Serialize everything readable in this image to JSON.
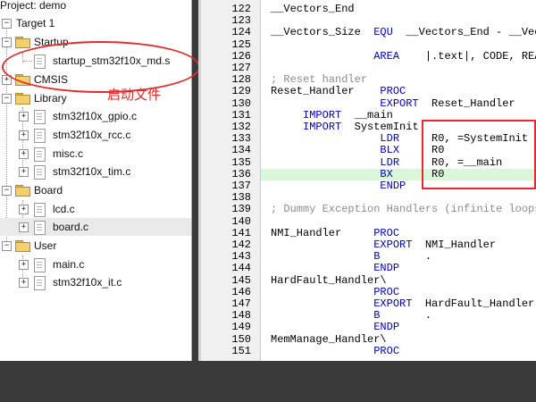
{
  "project": {
    "title": "Project: demo",
    "target": "Target 1",
    "groups": [
      {
        "name": "Startup",
        "files": [
          "startup_stm32f10x_md.s"
        ]
      },
      {
        "name": "CMSIS",
        "files": []
      },
      {
        "name": "Library",
        "files": [
          "stm32f10x_gpio.c",
          "stm32f10x_rcc.c",
          "misc.c",
          "stm32f10x_tim.c"
        ]
      },
      {
        "name": "Board",
        "files": [
          "lcd.c",
          "board.c"
        ]
      },
      {
        "name": "User",
        "files": [
          "main.c",
          "stm32f10x_it.c"
        ]
      }
    ]
  },
  "annotation": {
    "label": "启动文件",
    "color": "#e8282a"
  },
  "editor": {
    "highlight_line": "136",
    "lines": [
      {
        "no": "122",
        "code": "__Vectors_End",
        "kind": "plain"
      },
      {
        "no": "123",
        "code": "",
        "kind": "plain"
      },
      {
        "no": "124",
        "code": "__Vectors_Size  EQU  __Vectors_End - __Vectors",
        "kind": "plain"
      },
      {
        "no": "125",
        "code": "",
        "kind": "plain"
      },
      {
        "no": "126",
        "code": "                AREA    |.text|, CODE, READONLY",
        "kind": "plain"
      },
      {
        "no": "127",
        "code": "",
        "kind": "plain"
      },
      {
        "no": "128",
        "code": "; Reset handler",
        "kind": "comment"
      },
      {
        "no": "129",
        "code": "Reset_Handler    PROC",
        "kind": "plain"
      },
      {
        "no": "130",
        "code": "                 EXPORT  Reset_Handler",
        "kind": "plain"
      },
      {
        "no": "131",
        "code": "     IMPORT  __main",
        "kind": "plain"
      },
      {
        "no": "132",
        "code": "     IMPORT  SystemInit",
        "kind": "plain"
      },
      {
        "no": "133",
        "code": "                 LDR     R0, =SystemInit",
        "kind": "plain"
      },
      {
        "no": "134",
        "code": "                 BLX     R0",
        "kind": "plain"
      },
      {
        "no": "135",
        "code": "                 LDR     R0, =__main",
        "kind": "plain"
      },
      {
        "no": "136",
        "code": "                 BX      R0",
        "kind": "plain"
      },
      {
        "no": "137",
        "code": "                 ENDP",
        "kind": "plain"
      },
      {
        "no": "138",
        "code": "",
        "kind": "plain"
      },
      {
        "no": "139",
        "code": "; Dummy Exception Handlers (infinite loops which can be modified)",
        "kind": "comment"
      },
      {
        "no": "140",
        "code": "",
        "kind": "plain"
      },
      {
        "no": "141",
        "code": "NMI_Handler     PROC",
        "kind": "plain"
      },
      {
        "no": "142",
        "code": "                EXPORT  NMI_Handler",
        "kind": "plain"
      },
      {
        "no": "143",
        "code": "                B       .",
        "kind": "plain"
      },
      {
        "no": "144",
        "code": "                ENDP",
        "kind": "plain"
      },
      {
        "no": "145",
        "code": "HardFault_Handler\\",
        "kind": "plain"
      },
      {
        "no": "146",
        "code": "                PROC",
        "kind": "plain"
      },
      {
        "no": "147",
        "code": "                EXPORT  HardFault_Handler",
        "kind": "plain"
      },
      {
        "no": "148",
        "code": "                B       .",
        "kind": "plain"
      },
      {
        "no": "149",
        "code": "                ENDP",
        "kind": "plain"
      },
      {
        "no": "150",
        "code": "MemManage_Handler\\",
        "kind": "plain"
      },
      {
        "no": "151",
        "code": "                PROC",
        "kind": "plain"
      }
    ]
  }
}
